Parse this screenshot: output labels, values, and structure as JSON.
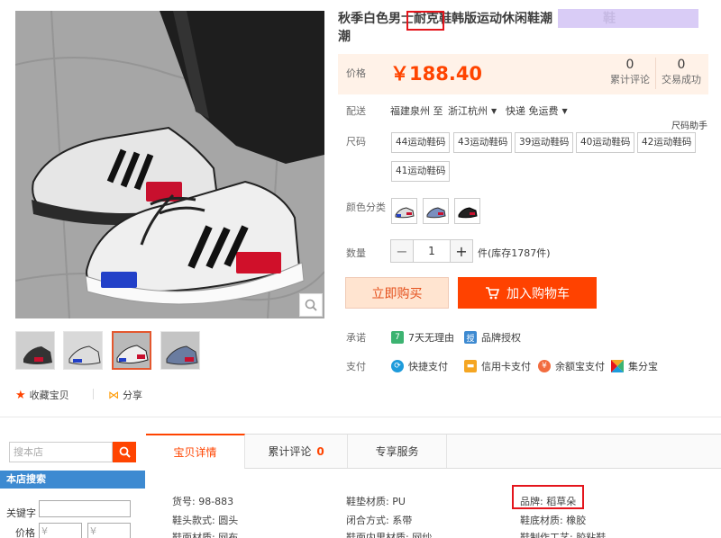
{
  "product": {
    "title": "秋季白色男士耐克鞋韩版运动休闲鞋潮",
    "title_hidden": "鞋",
    "title_line2": "潮",
    "highlight_word": "耐克"
  },
  "price": {
    "label": "价格",
    "value": "￥188.40",
    "reviews_count": "0",
    "reviews_label": "累计评论",
    "sales_count": "0",
    "sales_label": "交易成功"
  },
  "delivery": {
    "label": "配送",
    "from": "福建泉州 至",
    "to": "浙江杭州",
    "shipping": "快递 免运费"
  },
  "size_helper": "尺码助手",
  "size": {
    "label": "尺码",
    "options": [
      "44运动鞋码",
      "43运动鞋码",
      "39运动鞋码",
      "40运动鞋码",
      "42运动鞋码",
      "41运动鞋码"
    ]
  },
  "color": {
    "label": "颜色分类"
  },
  "quantity": {
    "label": "数量",
    "minus": "−",
    "value": "1",
    "plus": "+",
    "stock": "件(库存1787件)"
  },
  "buttons": {
    "buy_now": "立即购买",
    "add_cart": "加入购物车"
  },
  "promise": {
    "label": "承诺",
    "items": [
      "7天无理由",
      "品牌授权"
    ],
    "badges": [
      "7",
      "授"
    ]
  },
  "payment": {
    "label": "支付",
    "items": [
      "快捷支付",
      "信用卡支付",
      "余额宝支付",
      "集分宝"
    ]
  },
  "actions": {
    "favorite": "收藏宝贝",
    "share": "分享"
  },
  "shop": {
    "search_placeholder": "搜本店",
    "search_title": "本店搜索",
    "keyword_label": "关键字",
    "price_label": "价格",
    "currency": "¥"
  },
  "tabs": [
    {
      "label": "宝贝详情"
    },
    {
      "label": "累计评论",
      "count": "0"
    },
    {
      "label": "专享服务"
    }
  ],
  "attributes": [
    [
      "货号: 98-883",
      "鞋垫材质: PU",
      "品牌: 稻草朵"
    ],
    [
      "鞋头款式: 圆头",
      "闭合方式: 系带",
      "鞋底材质: 橡胶"
    ],
    [
      "鞋面材质: 网布",
      "鞋面内里材质: 网纱",
      "鞋制作工艺: 胶粘鞋"
    ]
  ],
  "colors": {
    "accent": "#ff4400",
    "price": "#ff4400",
    "tab_blue": "#3d8ad1",
    "highlight": "#e4151c"
  }
}
